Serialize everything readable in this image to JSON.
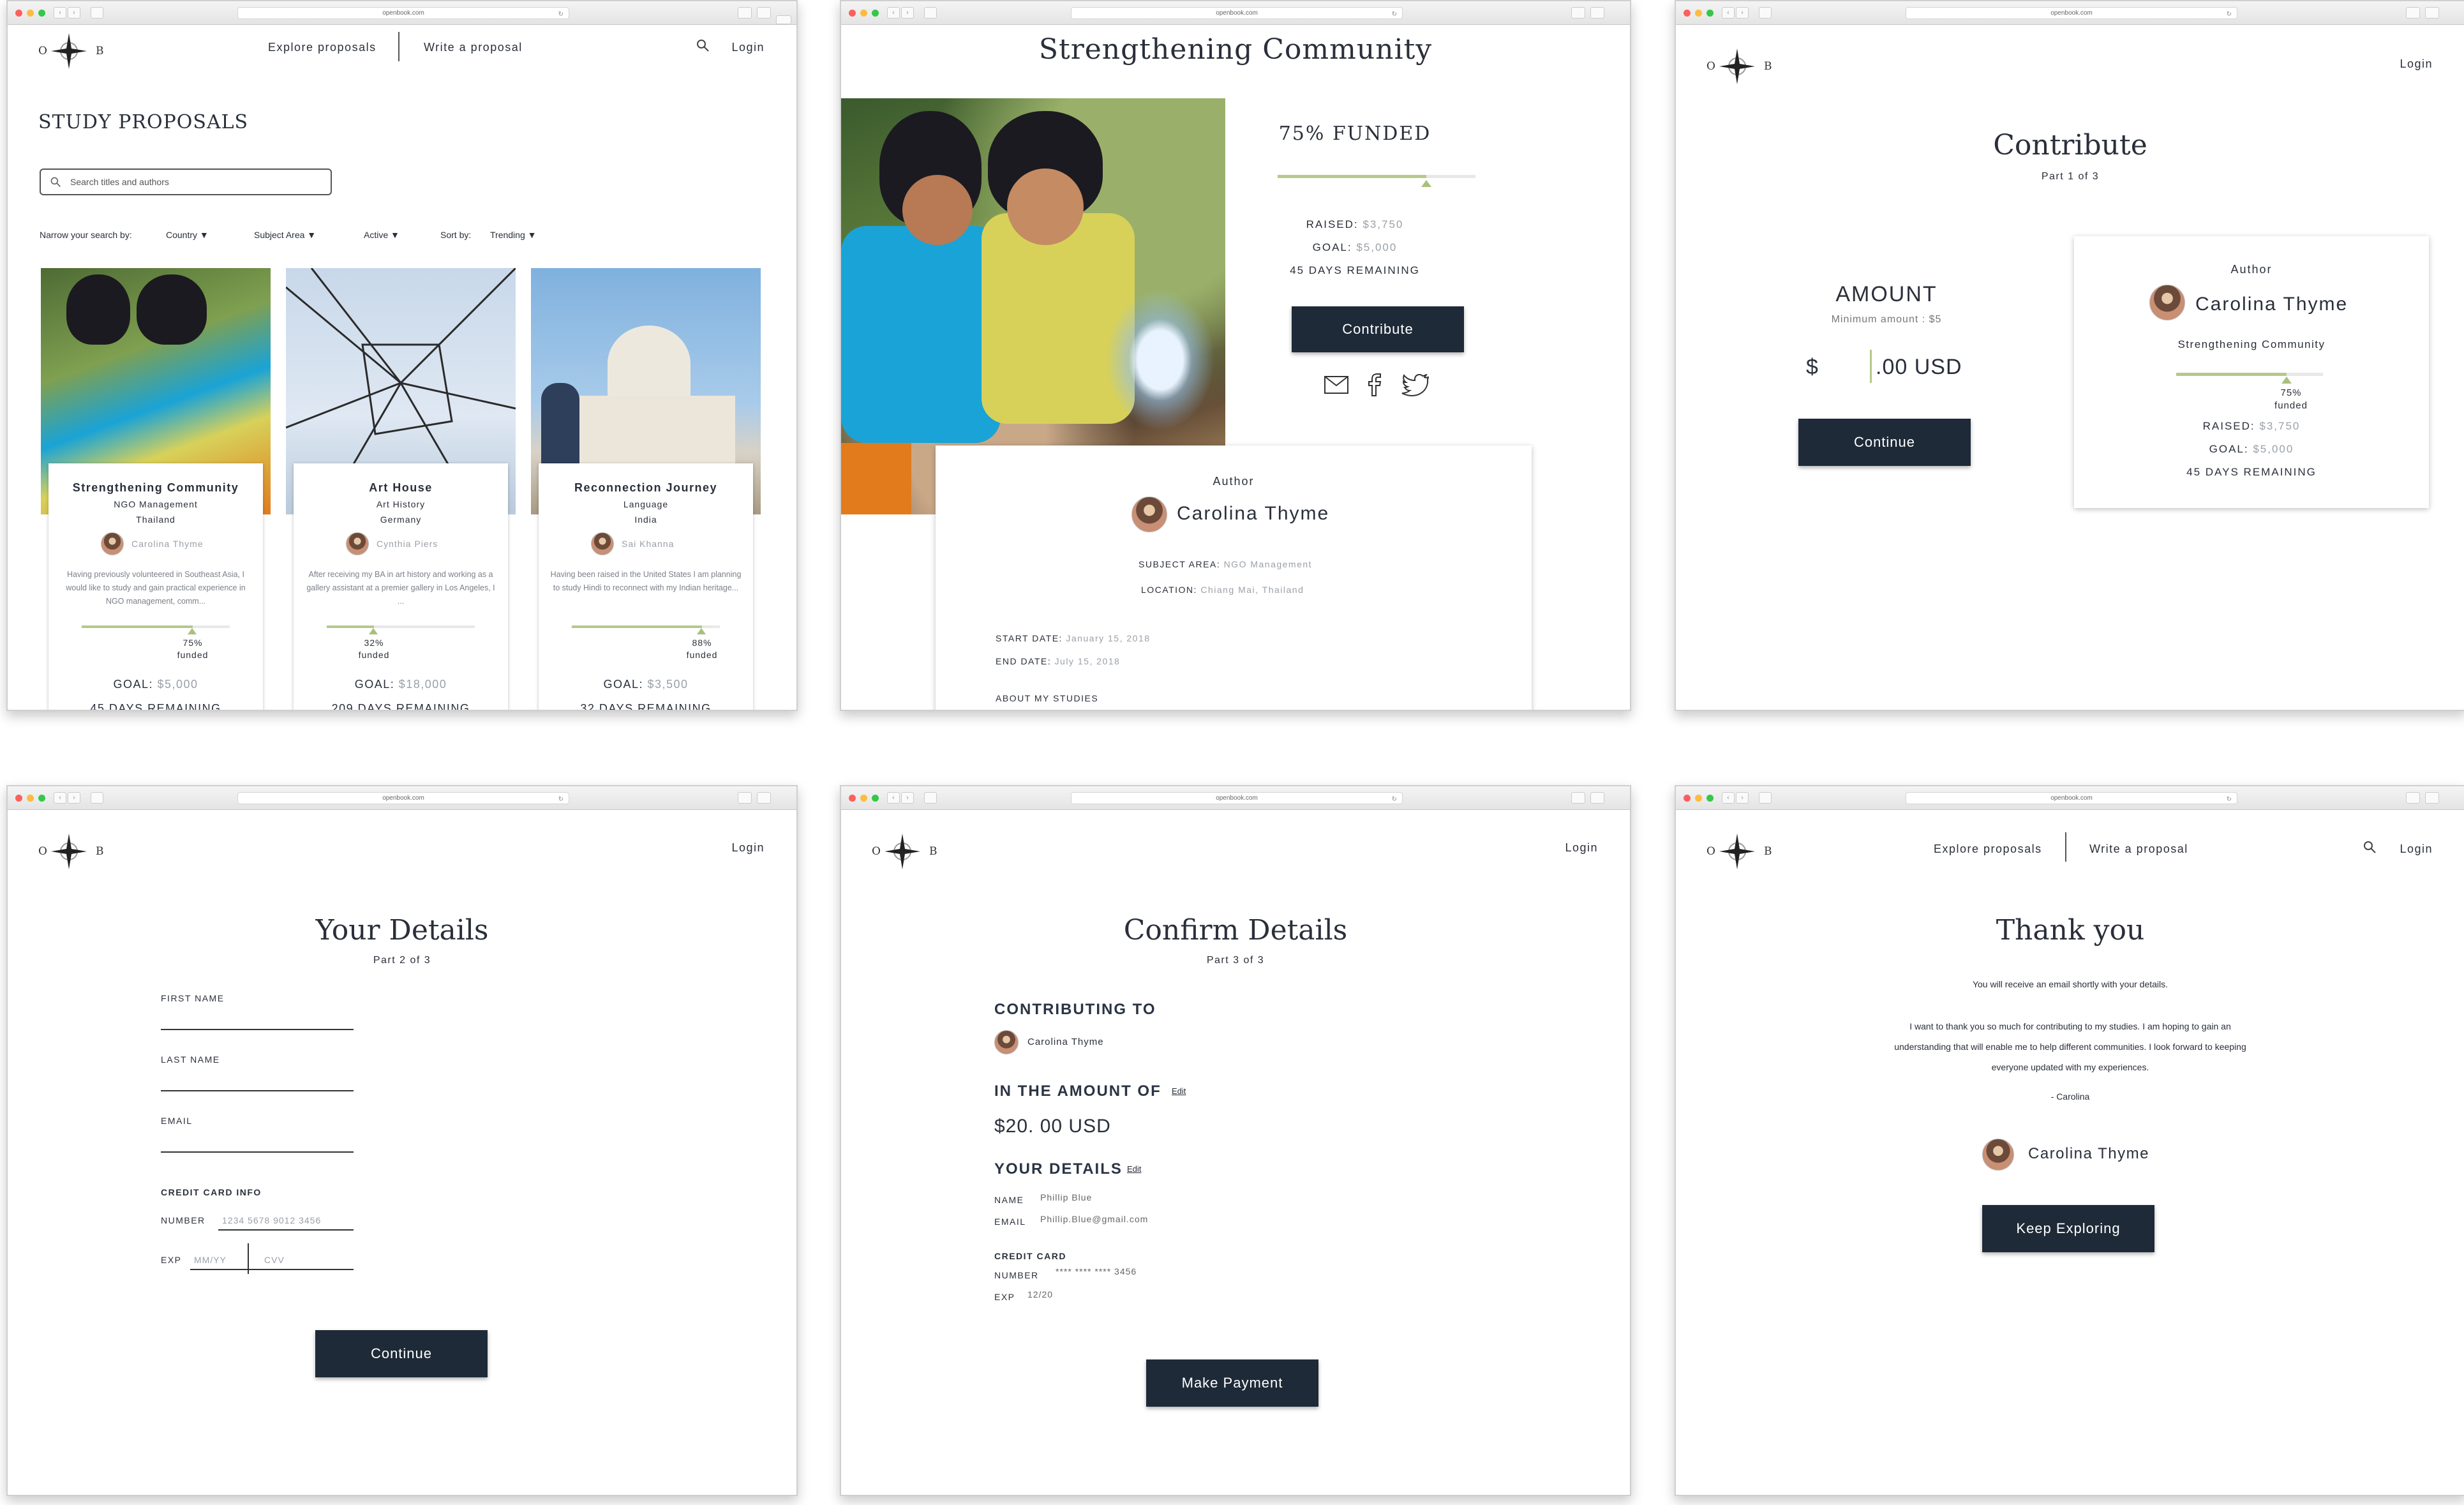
{
  "browser": {
    "url": "openbook.com"
  },
  "logo": {
    "left": "O",
    "right": "B"
  },
  "nav": {
    "explore": "Explore proposals",
    "write": "Write a proposal",
    "login": "Login"
  },
  "browse": {
    "title": "STUDY PROPOSALS",
    "search_placeholder": "Search titles and authors",
    "filters": {
      "narrow": "Narrow your search by:",
      "country": "Country",
      "subject": "Subject Area",
      "active": "Active",
      "sort_label": "Sort by:",
      "sort_value": "Trending"
    },
    "cards": [
      {
        "title": "Strengthening Community",
        "subject": "NGO Management",
        "country": "Thailand",
        "author": "Carolina Thyme",
        "blurb": "Having previously volunteered in Southeast Asia, I would like to study and gain practical experience in NGO management, comm...",
        "funded": "75%",
        "funded_label": "funded",
        "funded_value": 0.75,
        "goal_label": "GOAL:",
        "goal": "$5,000",
        "days": "45 DAYS REMAINING"
      },
      {
        "title": "Art House",
        "subject": "Art History",
        "country": "Germany",
        "author": "Cynthia Piers",
        "blurb": "After receiving my BA in art history and working as a gallery assistant at a premier gallery in Los Angeles, I ...",
        "funded": "32%",
        "funded_label": "funded",
        "funded_value": 0.32,
        "goal_label": "GOAL:",
        "goal": "$18,000",
        "days": "209 DAYS REMAINING"
      },
      {
        "title": "Reconnection Journey",
        "subject": "Language",
        "country": "India",
        "author": "Sai Khanna",
        "blurb": "Having been raised in the United States I am planning to study Hindi to reconnect with my Indian heritage...",
        "funded": "88%",
        "funded_label": "funded",
        "funded_value": 0.88,
        "goal_label": "GOAL:",
        "goal": "$3,500",
        "days": "32 DAYS REMAINING"
      }
    ]
  },
  "proposal": {
    "title": "Strengthening Community",
    "funded": "75% FUNDED",
    "funded_value": 0.75,
    "raised_label": "RAISED:",
    "raised": "$3,750",
    "goal_label": "GOAL:",
    "goal": "$5,000",
    "days": "45 DAYS REMAINING",
    "contribute": "Contribute",
    "author_label": "Author",
    "author": "Carolina Thyme",
    "subject_label": "SUBJECT AREA:",
    "subject": "NGO Management",
    "location_label": "LOCATION:",
    "location": "Chiang Mai, Thailand",
    "start_label": "START DATE:",
    "start": "January 15, 2018",
    "end_label": "END DATE:",
    "end": "July 15, 2018",
    "about": "ABOUT MY STUDIES"
  },
  "contribute": {
    "title": "Contribute",
    "part": "Part 1 of 3",
    "amount_title": "AMOUNT",
    "minimum": "Minimum amount : $5",
    "currency": "$",
    "amount_suffix": ".00 USD",
    "continue": "Continue",
    "card": {
      "author_label": "Author",
      "author": "Carolina Thyme",
      "project": "Strengthening Community",
      "funded": "75%",
      "funded_label": "funded",
      "funded_value": 0.75,
      "raised_label": "RAISED:",
      "raised": "$3,750",
      "goal_label": "GOAL:",
      "goal": "$5,000",
      "days": "45 DAYS REMAINING"
    }
  },
  "details": {
    "title": "Your Details",
    "part": "Part 2 of 3",
    "first": "FIRST NAME",
    "last": "LAST NAME",
    "email": "EMAIL",
    "cc": "CREDIT CARD INFO",
    "number_label": "NUMBER",
    "number_placeholder": "1234 5678 9012 3456",
    "exp_label": "EXP",
    "exp_placeholder": "MM/YY",
    "cvv_placeholder": "CVV",
    "continue": "Continue"
  },
  "confirm": {
    "title": "Confirm Details",
    "part": "Part 3 of 3",
    "to_label": "CONTRIBUTING TO",
    "to": "Carolina Thyme",
    "amount_label": "IN THE AMOUNT OF",
    "edit": "Edit",
    "amount": "$20. 00 USD",
    "details_label": "YOUR DETAILS",
    "name_label": "NAME",
    "name": "Phillip Blue",
    "email_label": "EMAIL",
    "email": "Phillip.Blue@gmail.com",
    "cc_label": "CREDIT CARD",
    "number_label": "NUMBER",
    "number": "**** **** **** 3456",
    "exp_label": "EXP",
    "exp": "12/20",
    "pay": "Make Payment"
  },
  "thanks": {
    "title": "Thank you",
    "line1": "You will receive an email shortly with your details.",
    "msg1": "I want to thank you so much for contributing to my studies. I am hoping to gain an",
    "msg2": "understanding that will enable me to help different communities. I look forward to keeping",
    "msg3": "everyone updated with my experiences.",
    "sign": "- Carolina",
    "author": "Carolina Thyme",
    "keep": "Keep Exploring"
  }
}
